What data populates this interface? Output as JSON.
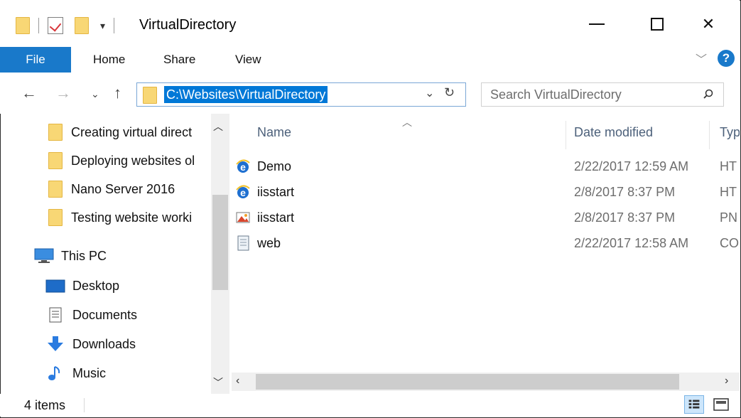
{
  "window": {
    "title": "VirtualDirectory"
  },
  "ribbon": {
    "tabs": [
      "File",
      "Home",
      "Share",
      "View"
    ]
  },
  "address": {
    "path": "C:\\Websites\\VirtualDirectory"
  },
  "search": {
    "placeholder": "Search VirtualDirectory"
  },
  "nav_pane": {
    "folders": [
      "Creating  virtual direct",
      "Deploying websites ol",
      "Nano Server 2016",
      "Testing website worki"
    ],
    "this_pc": "This PC",
    "items": [
      {
        "label": "Desktop",
        "icon": "desktop-icon"
      },
      {
        "label": "Documents",
        "icon": "documents-icon"
      },
      {
        "label": "Downloads",
        "icon": "downloads-icon"
      },
      {
        "label": "Music",
        "icon": "music-icon"
      }
    ]
  },
  "file_list": {
    "columns": [
      "Name",
      "Date modified",
      "Typ"
    ],
    "rows": [
      {
        "name": "Demo",
        "date": "2/22/2017 12:59 AM",
        "type": "HT",
        "icon": "ie-html-icon"
      },
      {
        "name": "iisstart",
        "date": "2/8/2017 8:37 PM",
        "type": "HT",
        "icon": "ie-html-icon"
      },
      {
        "name": "iisstart",
        "date": "2/8/2017 8:37 PM",
        "type": "PN",
        "icon": "png-image-icon"
      },
      {
        "name": "web",
        "date": "2/22/2017 12:58 AM",
        "type": "CO",
        "icon": "config-file-icon"
      }
    ]
  },
  "status": {
    "item_count": "4 items"
  },
  "colors": {
    "accent": "#1979ca",
    "selection": "#0078d7",
    "folder": "#f8d775"
  }
}
